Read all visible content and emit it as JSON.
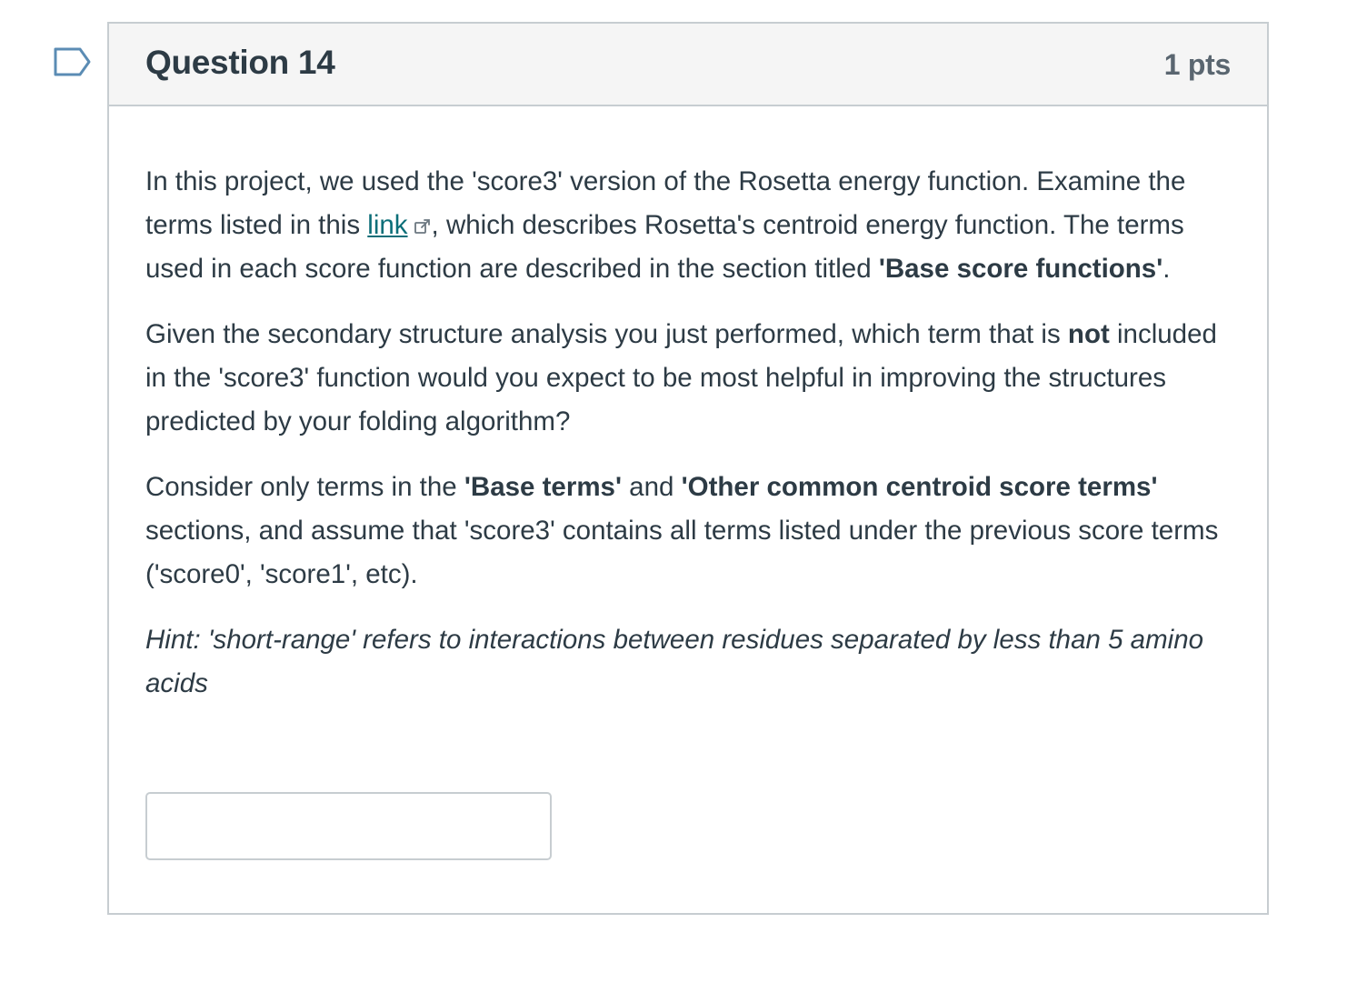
{
  "question": {
    "title": "Question 14",
    "points": "1 pts",
    "flag_icon": "bookmark-flag-icon"
  },
  "body": {
    "p1": {
      "before_link": "In this project, we used the 'score3' version of the Rosetta energy function. Examine the terms listed in this ",
      "link_text": "link",
      "link_icon": "external-link-icon",
      "after_link": ", which describes Rosetta's centroid energy function. The terms used in each score function are described in the section titled ",
      "bold": "'Base score functions'",
      "end": "."
    },
    "p2": {
      "before_bold": "Given the secondary structure analysis you just performed, which term that is ",
      "bold": "not",
      "after_bold": " included in the 'score3' function would you expect to be most helpful in improving the structures predicted by your folding algorithm?"
    },
    "p3": {
      "text1": "Consider only terms in the ",
      "bold1": "'Base terms'",
      "text2": " and ",
      "bold2": "'Other common centroid score terms'",
      "text3": " sections, and assume that 'score3' contains all terms listed under the previous score terms ('score0', 'score1', etc)."
    },
    "hint": "Hint: 'short-range' refers to interactions between residues separated by less than 5 amino acids"
  },
  "answer": {
    "value": "",
    "placeholder": ""
  },
  "colors": {
    "link": "#0b6e78",
    "border": "#c7cdd1",
    "header_bg": "#f5f5f5",
    "text": "#2d3b45",
    "flag": "#5b8cb4"
  }
}
